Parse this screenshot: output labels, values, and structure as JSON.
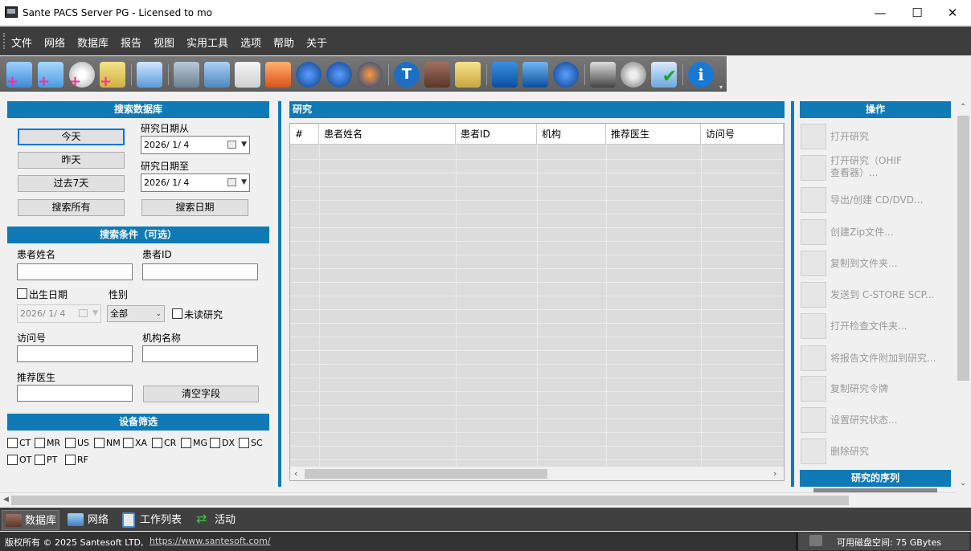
{
  "window": {
    "title": "Sante PACS Server PG - Licensed to mo"
  },
  "menu": [
    "文件",
    "网络",
    "数据库",
    "报告",
    "视图",
    "实用工具",
    "选项",
    "帮助",
    "关于"
  ],
  "search": {
    "header": "搜索数据库",
    "today": "今天",
    "yesterday": "昨天",
    "last7": "过去7天",
    "search_all": "搜索所有",
    "date_from_label": "研究日期从",
    "date_from": "2026/  1/  4",
    "date_to_label": "研究日期至",
    "date_to": "2026/  1/  4",
    "search_date": "搜索日期"
  },
  "criteria": {
    "header": "搜索条件（可选）",
    "patient_name_label": "患者姓名",
    "patient_id_label": "患者ID",
    "dob_label": "出生日期",
    "dob_value": "2026/  1/  4",
    "sex_label": "性别",
    "sex_value": "全部",
    "unread_label": "未读研究",
    "accession_label": "访问号",
    "institution_label": "机构名称",
    "referring_label": "推荐医生",
    "clear_fields": "清空字段"
  },
  "modality": {
    "header": "设备筛选",
    "row1": [
      "CT",
      "MR",
      "US",
      "NM",
      "XA",
      "CR",
      "MG",
      "DX",
      "SC"
    ],
    "row2": [
      "OT",
      "PT",
      "RF"
    ]
  },
  "studies": {
    "header": "研究",
    "columns": [
      "#",
      "患者姓名",
      "患者ID",
      "机构",
      "推荐医生",
      "访问号"
    ]
  },
  "actions": {
    "header": "操作",
    "items": [
      {
        "icon": "open-study-icon",
        "label": "打开研究"
      },
      {
        "icon": "ohif-viewer-icon",
        "label": "打开研究（OHIF\n查看器）..."
      },
      {
        "icon": "cd-dvd-icon",
        "label": "导出/创建 CD/DVD..."
      },
      {
        "icon": "zip-icon",
        "label": "创建Zip文件..."
      },
      {
        "icon": "copy-folder-icon",
        "label": "复制到文件夹..."
      },
      {
        "icon": "send-scp-icon",
        "label": "发送到 C-STORE SCP..."
      },
      {
        "icon": "folder-icon",
        "label": "打开检查文件夹..."
      },
      {
        "icon": "attach-report-icon",
        "label": "将报告文件附加到研究..."
      },
      {
        "icon": "copy-token-icon",
        "label": "复制研究令牌"
      },
      {
        "icon": "study-status-icon",
        "label": "设置研究状态..."
      },
      {
        "icon": "delete-study-icon",
        "label": "删除研究"
      }
    ],
    "series_header": "研究的序列"
  },
  "bottom_tabs": [
    {
      "icon": "database-icon",
      "label": "数据库"
    },
    {
      "icon": "network-icon",
      "label": "网络"
    },
    {
      "icon": "worklist-icon",
      "label": "工作列表"
    },
    {
      "icon": "activity-icon",
      "label": "活动"
    }
  ],
  "status": {
    "copyright": "版权所有 © 2025 Santesoft LTD,",
    "url": "https://www.santesoft.com/",
    "disk": "可用磁盘空间: 75 GBytes"
  },
  "colors": {
    "accent": "#0f7ab5",
    "menubar": "#3d3d3d",
    "toolbar": "#666666"
  }
}
